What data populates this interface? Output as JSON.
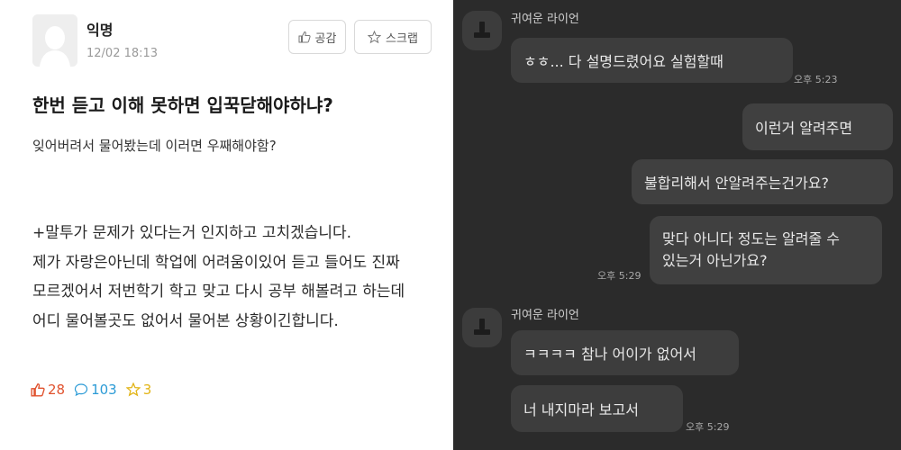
{
  "post": {
    "author": "익명",
    "datetime": "12/02 18:13",
    "like_button_label": "공감",
    "scrap_button_label": "스크랩",
    "title": "한번 듣고 이해 못하면 입꾹닫해야하냐?",
    "subtitle": "잊어버려서 물어봤는데 이러면 우째해야함?",
    "body_lines": [
      "+말투가 문제가 있다는거 인지하고 고치겠습니다.",
      "제가 자랑은아닌데 학업에 어려움이있어 듣고 들어도 진짜",
      "모르겠어서 저번학기 학고 맞고 다시 공부 해볼려고 하는데",
      "어디 물어볼곳도 없어서 물어본 상황이긴합니다."
    ],
    "stats": {
      "likes": "28",
      "comments": "103",
      "scraps": "3"
    },
    "colors": {
      "like": "#e0522e",
      "comment": "#2c9bd6",
      "scrap": "#e2b416"
    },
    "icons": {
      "avatar": "anonymous-person-icon",
      "like": "thumbs-up-icon",
      "scrap": "star-icon",
      "comment": "speech-bubble-icon"
    }
  },
  "chat": {
    "contact_name": "귀여운 라이언",
    "group1": {
      "sender": "귀여운 라이언",
      "message": "ㅎㅎ... 다 설명드렸어요 실험할때",
      "time": "오후 5:23"
    },
    "my_messages": {
      "msg1": "이런거 알려주면",
      "msg2": "불합리해서 안알려주는건가요?",
      "msg3_line1": "맞다 아니다 정도는 알려줄 수",
      "msg3_line2": "있는거 아닌가요?",
      "time": "오후 5:29"
    },
    "group2": {
      "sender": "귀여운 라이언",
      "message1": "ㅋㅋㅋㅋ 참나 어이가 없어서",
      "message2": "너 내지마라 보고서",
      "time": "오후 5:29"
    },
    "colors": {
      "background": "#2b2b2b",
      "bubble": "#3d3d3d",
      "text": "#e9e9e9"
    }
  }
}
